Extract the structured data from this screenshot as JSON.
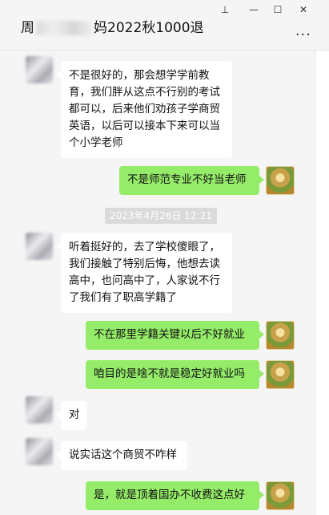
{
  "window": {
    "title_prefix": "周",
    "title_suffix": "妈2022秋1000退",
    "pin_glyph": "⊥",
    "min_glyph": "—",
    "max_glyph": "☐",
    "close_glyph": "✕",
    "more_glyph": "..."
  },
  "timestamp": "2023年4月26日 12:21",
  "messages": [
    {
      "side": "left",
      "text": "不是很好的，那会想学学前教育，我们胖从这点不行别的考试都可以，后来他们劝孩子学商贸英语，以后可以接本下来可以当个小学老师"
    },
    {
      "side": "right",
      "text": "不是师范专业不好当老师"
    },
    {
      "side": "left",
      "text": "听着挺好的，去了学校傻眼了，我们接触了特别后悔，他想去读高中，也问高中了，人家说不行了我们有了职高学籍了"
    },
    {
      "side": "right",
      "text": "不在那里学籍关键以后不好就业"
    },
    {
      "side": "right",
      "text": "咱目的是啥不就是稳定好就业吗"
    },
    {
      "side": "left",
      "text": "对"
    },
    {
      "side": "left",
      "text": "说实话这个商贸不咋样"
    },
    {
      "side": "right",
      "text": "是，就是顶着国办不收费这点好"
    }
  ]
}
